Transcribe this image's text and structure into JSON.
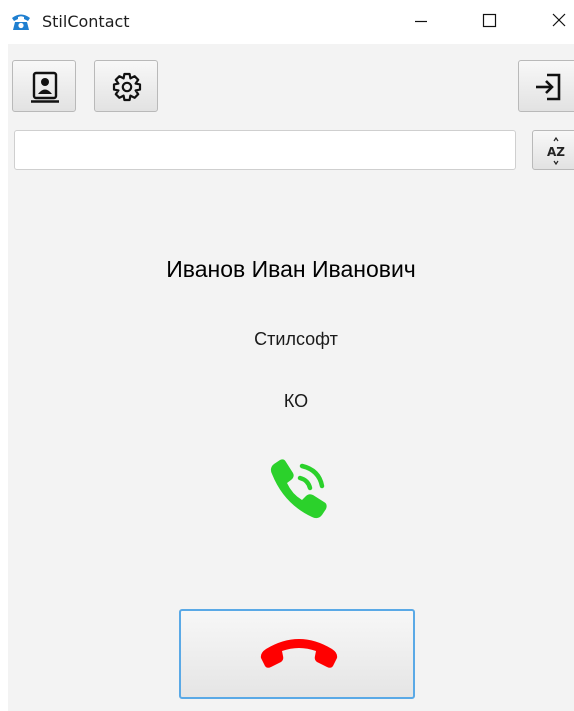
{
  "window": {
    "title": "StilContact",
    "controls": [
      "minimize-icon",
      "maximize-icon",
      "close-icon"
    ]
  },
  "toolbar": {
    "buttons": [
      "contacts-icon",
      "gear-icon",
      "exit-icon",
      "sort-az-icon"
    ],
    "sort_label": "AZ"
  },
  "search": {
    "value": "",
    "placeholder": ""
  },
  "contact": {
    "name": "Иванов Иван Иванович",
    "company": "Стилсофт",
    "department": "КО"
  },
  "call": {
    "incoming_icon": "phone-ringing-icon",
    "hangup_icon": "hangup-icon",
    "colors": {
      "accept": "#2bd12b",
      "hangup": "#ff0000",
      "focus": "#5aa9e6"
    }
  }
}
